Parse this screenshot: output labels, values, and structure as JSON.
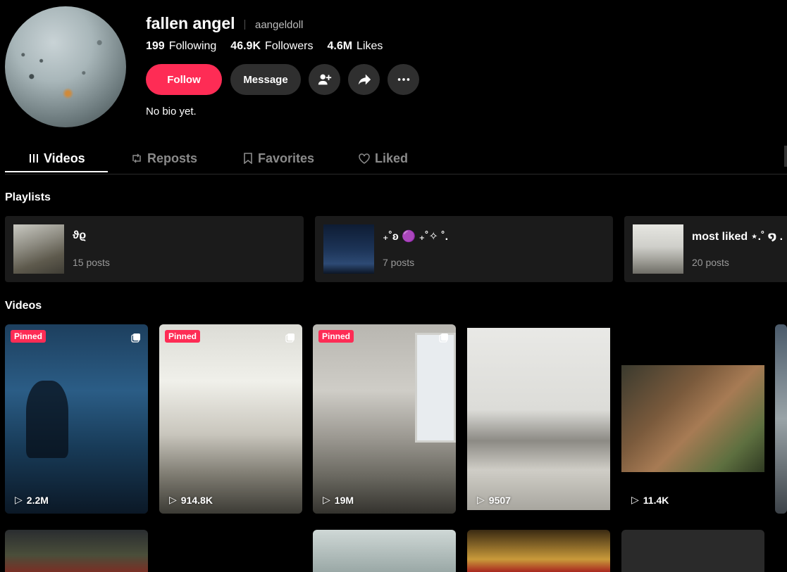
{
  "profile": {
    "display_name": "fallen angel",
    "username": "aangeldoll",
    "stats": [
      {
        "value": "199",
        "label": "Following"
      },
      {
        "value": "46.9K",
        "label": "Followers"
      },
      {
        "value": "4.6M",
        "label": "Likes"
      }
    ],
    "follow_label": "Follow",
    "message_label": "Message",
    "bio": "No bio yet."
  },
  "tabs": [
    {
      "label": "Videos",
      "icon": "grid-icon"
    },
    {
      "label": "Reposts",
      "icon": "repost-icon"
    },
    {
      "label": "Favorites",
      "icon": "bookmark-icon"
    },
    {
      "label": "Liked",
      "icon": "heart-icon"
    }
  ],
  "playlists_title": "Playlists",
  "playlists": [
    {
      "title": "ϑϱ",
      "count": "15 posts"
    },
    {
      "title": "₊˚ʚ 🟣 ₊˚✧ ˚.",
      "count": "7 posts"
    },
    {
      "title": "most liked ⋆.˚ ໑ .",
      "count": "20 posts"
    }
  ],
  "videos_title": "Videos",
  "videos": [
    {
      "views": "2.2M",
      "pinned": "Pinned"
    },
    {
      "views": "914.8K",
      "pinned": "Pinned"
    },
    {
      "views": "19M",
      "pinned": "Pinned"
    },
    {
      "views": "9507"
    },
    {
      "views": "11.4K"
    }
  ],
  "colors": {
    "accent": "#fe2c55",
    "background": "#000000",
    "card": "#1b1b1b"
  }
}
